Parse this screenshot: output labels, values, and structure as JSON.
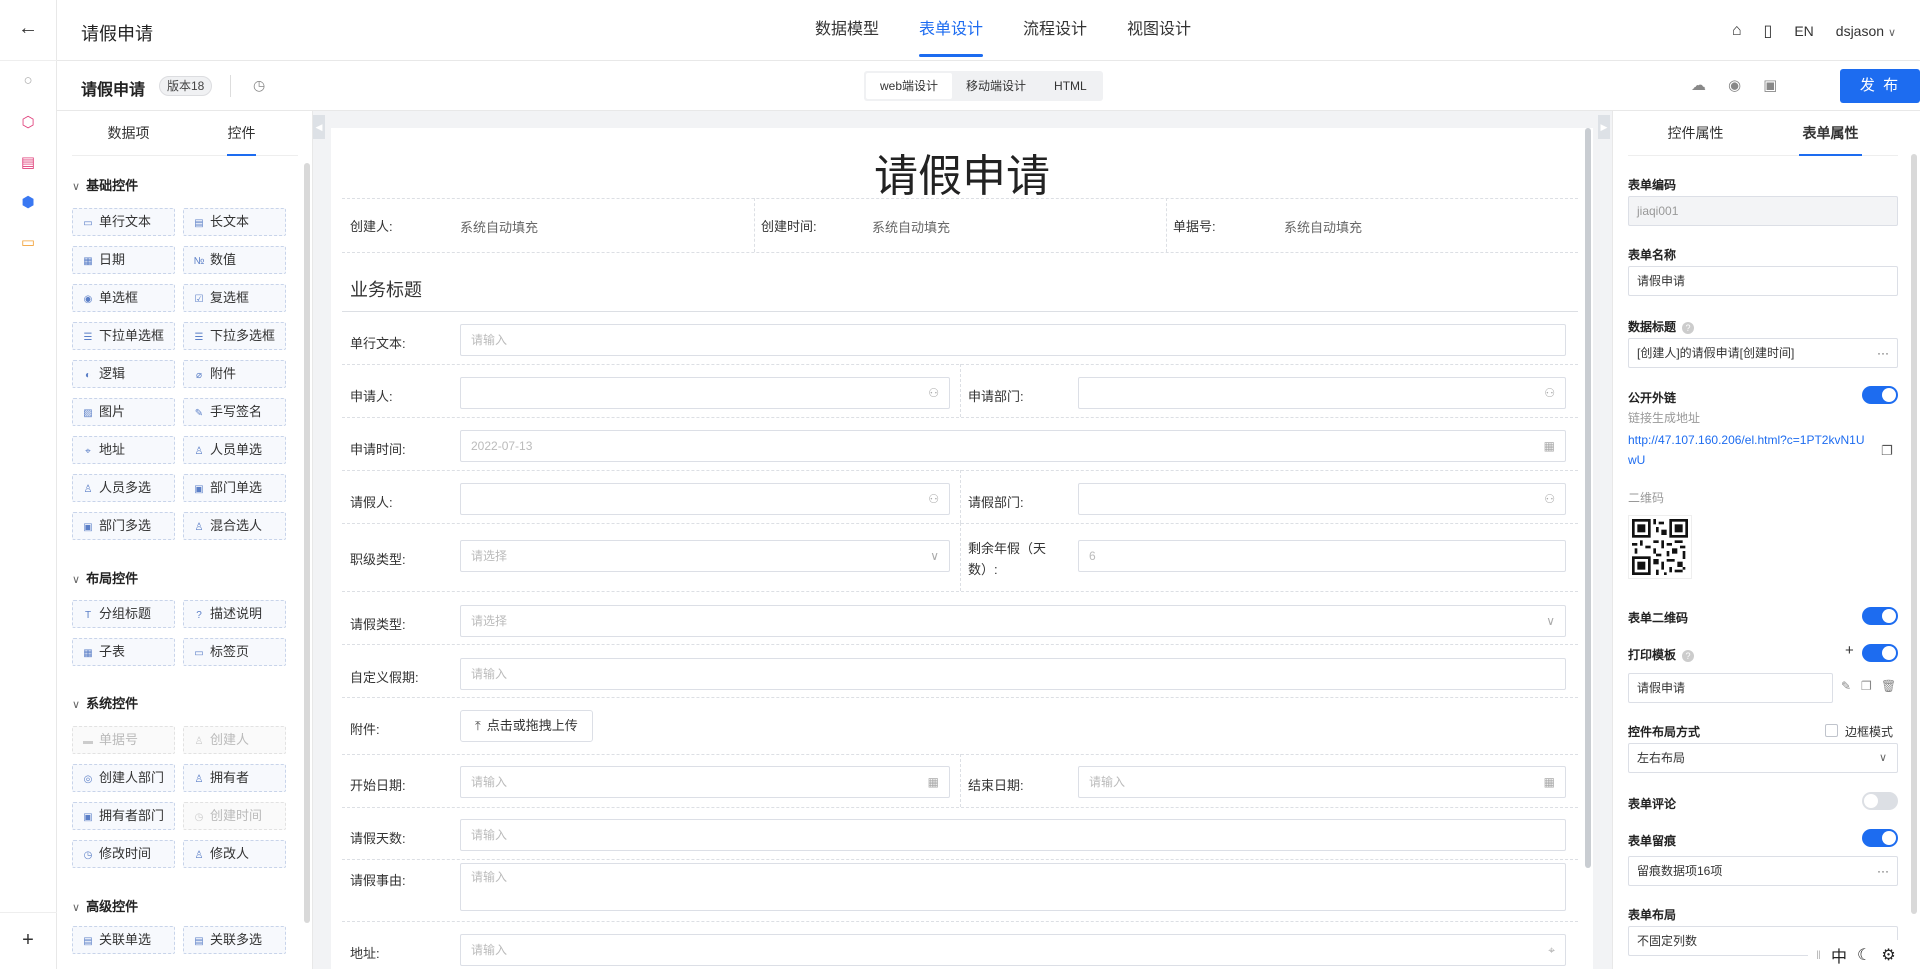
{
  "rail": {
    "back_icon": "arrow-left-icon"
  },
  "topnav": {
    "app_title": "请假申请",
    "tabs": [
      "数据模型",
      "表单设计",
      "流程设计",
      "视图设计"
    ],
    "lang": "EN",
    "user": "dsjason"
  },
  "subbar": {
    "form_title": "请假申请",
    "version": "版本18",
    "modes": [
      "web端设计",
      "移动端设计",
      "HTML"
    ],
    "publish": "发 布"
  },
  "left": {
    "tabs": [
      "数据项",
      "控件"
    ],
    "sections": {
      "basic": "基础控件",
      "layout": "布局控件",
      "system": "系统控件",
      "advanced": "高级控件"
    },
    "basic": [
      "单行文本",
      "长文本",
      "日期",
      "数值",
      "单选框",
      "复选框",
      "下拉单选框",
      "下拉多选框",
      "逻辑",
      "附件",
      "图片",
      "手写签名",
      "地址",
      "人员单选",
      "人员多选",
      "部门单选",
      "部门多选",
      "混合选人"
    ],
    "layout": [
      "分组标题",
      "描述说明",
      "子表",
      "标签页"
    ],
    "system": [
      "单据号",
      "创建人",
      "创建人部门",
      "拥有者",
      "拥有者部门",
      "创建时间",
      "修改时间",
      "修改人"
    ],
    "advanced": [
      "关联单选",
      "关联多选"
    ]
  },
  "canvas": {
    "title": "请假申请",
    "creator_label": "创建人:",
    "creator_value": "系统自动填充",
    "ctime_label": "创建时间:",
    "ctime_value": "系统自动填充",
    "docno_label": "单据号:",
    "docno_value": "系统自动填充",
    "group_title": "业务标题",
    "single_label": "单行文本:",
    "single_ph": "请输入",
    "applicant_label": "申请人:",
    "apply_dept_label": "申请部门:",
    "apply_time_label": "申请时间:",
    "apply_time_value": "2022-07-13",
    "leave_person_label": "请假人:",
    "leave_dept_label": "请假部门:",
    "rank_label": "职级类型:",
    "rank_ph": "请选择",
    "annual_label_1": "剩余年假（天",
    "annual_label_2": "数）:",
    "annual_value": "6",
    "leave_type_label": "请假类型:",
    "leave_type_ph": "请选择",
    "custom_label": "自定义假期:",
    "custom_ph": "请输入",
    "attach_label": "附件:",
    "upload_text": "点击或拖拽上传",
    "start_label": "开始日期:",
    "start_ph": "请输入",
    "end_label": "结束日期:",
    "end_ph": "请输入",
    "days_label": "请假天数:",
    "days_ph": "请输入",
    "reason_label": "请假事由:",
    "reason_ph": "请输入",
    "address_label": "地址:",
    "address_ph": "请输入"
  },
  "right": {
    "tabs": [
      "控件属性",
      "表单属性"
    ],
    "code_label": "表单编码",
    "code_value": "jiaqi001",
    "name_label": "表单名称",
    "name_value": "请假申请",
    "data_title_label": "数据标题",
    "data_title_value": "[创建人]的请假申请[创建时间]",
    "public_link_label": "公开外链",
    "link_hint": "链接生成地址",
    "link_url": "http://47.107.160.206/el.html?c=1PT2kvN1UwU",
    "qr_label": "二维码",
    "form_qr_label": "表单二维码",
    "print_label": "打印模板",
    "print_value": "请假申请",
    "layout_label": "控件布局方式",
    "border_mode": "边框模式",
    "layout_value": "左右布局",
    "comment_label": "表单评论",
    "trace_label": "表单留痕",
    "trace_value": "留痕数据项16项",
    "form_layout_label": "表单布局",
    "form_layout_value": "不固定列数"
  },
  "corner": {
    "lang_char": "中"
  },
  "colors": {
    "accent": "#1d6cf0",
    "page_bg": "#f2f3f5"
  }
}
